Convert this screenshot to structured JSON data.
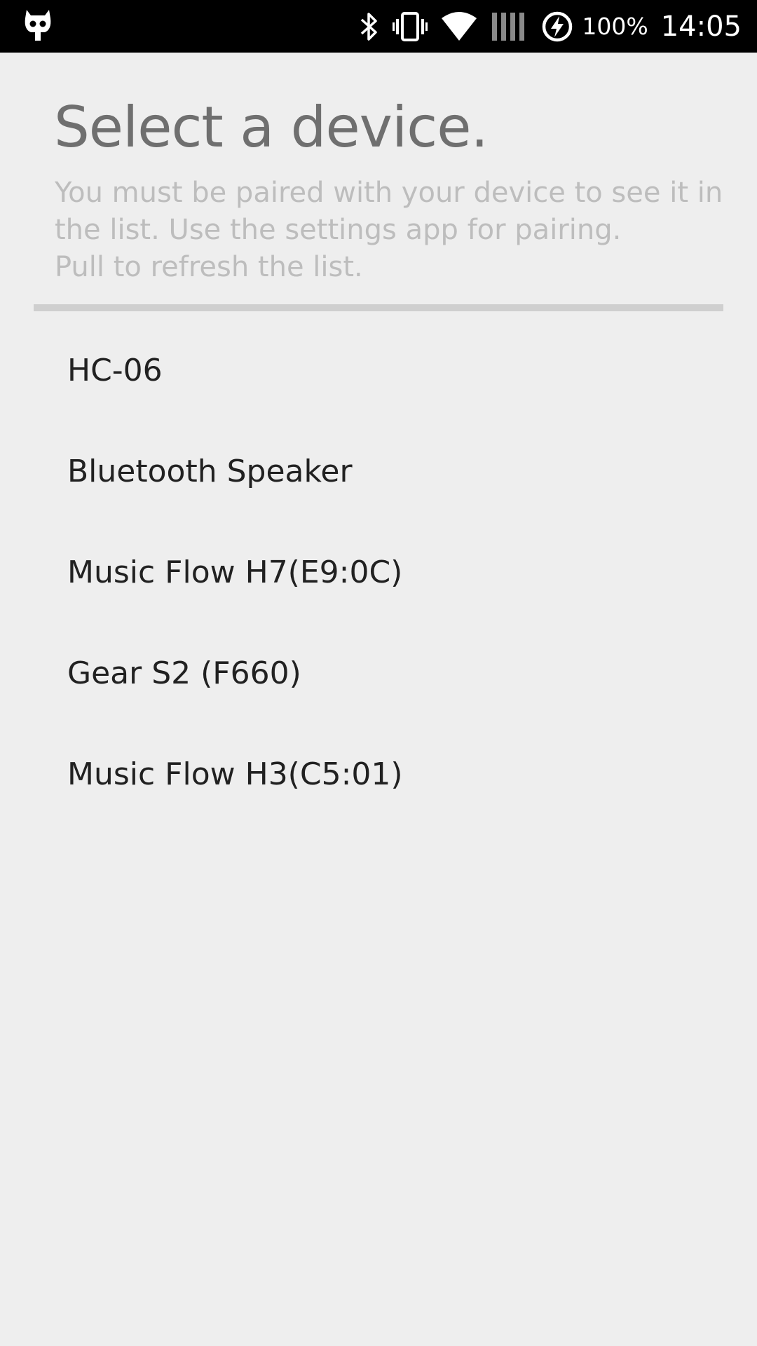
{
  "status_bar": {
    "left_icon": "cyanogenmod-icon",
    "icons": [
      "bluetooth-icon",
      "vibrate-icon",
      "wifi-icon",
      "no-signal-icon",
      "battery-charging-icon"
    ],
    "battery_percent": "100%",
    "time": "14:05",
    "background": "#000000"
  },
  "header": {
    "title": "Select a device.",
    "subtitle_lines": [
      "You must be paired with your device to see it in",
      "the list. Use the settings app for pairing.",
      "Pull to refresh the list."
    ]
  },
  "devices": [
    {
      "name": "HC-06"
    },
    {
      "name": "Bluetooth Speaker"
    },
    {
      "name": "Music Flow H7(E9:0C)"
    },
    {
      "name": "Gear S2 (F660)"
    },
    {
      "name": "Music Flow H3(C5:01)"
    }
  ],
  "colors": {
    "background": "#eeeeee",
    "title": "#6f6f6f",
    "subtitle": "#bdbdbd",
    "divider": "#cfcfcf",
    "item_text": "#212121"
  }
}
